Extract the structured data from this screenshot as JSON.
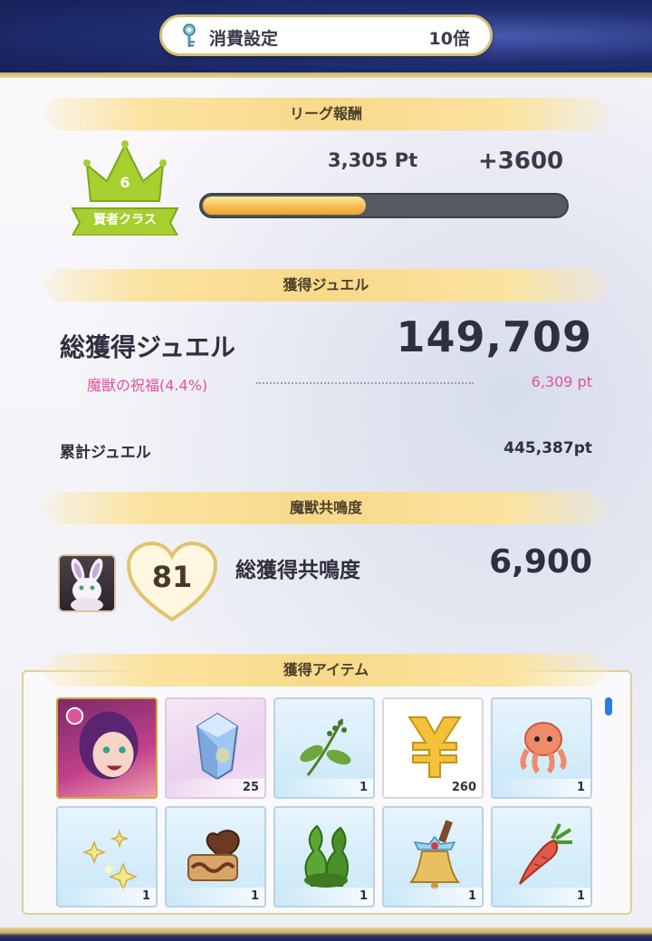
{
  "header": {
    "cost_label": "消費設定",
    "cost_value": "10倍"
  },
  "league": {
    "banner": "リーグ報酬",
    "rank_number": "6",
    "rank_label": "賢者クラス",
    "points": "3,305 Pt",
    "bonus": "+3600",
    "progress": 0.55
  },
  "jewel": {
    "banner": "獲得ジュエル",
    "total_label": "総獲得ジュエル",
    "total_value": "149,709",
    "blessing_label": "魔獣の祝福(4.4%)",
    "blessing_value": "6,309 pt",
    "cumulative_label": "累計ジュエル",
    "cumulative_value": "445,387pt"
  },
  "resonance": {
    "banner": "魔獣共鳴度",
    "level": "81",
    "total_label": "総獲得共鳴度",
    "total_value": "6,900"
  },
  "items": {
    "banner": "獲得アイテム",
    "list": [
      {
        "name": "character-card-icon",
        "qty": ""
      },
      {
        "name": "crystal-icon",
        "qty": "25"
      },
      {
        "name": "herb-sprig-icon",
        "qty": "1"
      },
      {
        "name": "yen-coin-icon",
        "qty": "260"
      },
      {
        "name": "octopus-icon",
        "qty": "1"
      },
      {
        "name": "sparkles-icon",
        "qty": "1"
      },
      {
        "name": "cookies-icon",
        "qty": "1"
      },
      {
        "name": "seaweed-icon",
        "qty": "1"
      },
      {
        "name": "bell-icon",
        "qty": "1"
      },
      {
        "name": "carrot-icon",
        "qty": "1"
      }
    ]
  },
  "colors": {
    "accent_gold": "#f7d98a",
    "pink": "#e0529a",
    "progress_fill": "#f6b84a",
    "crown_green": "#a6cf2f"
  }
}
